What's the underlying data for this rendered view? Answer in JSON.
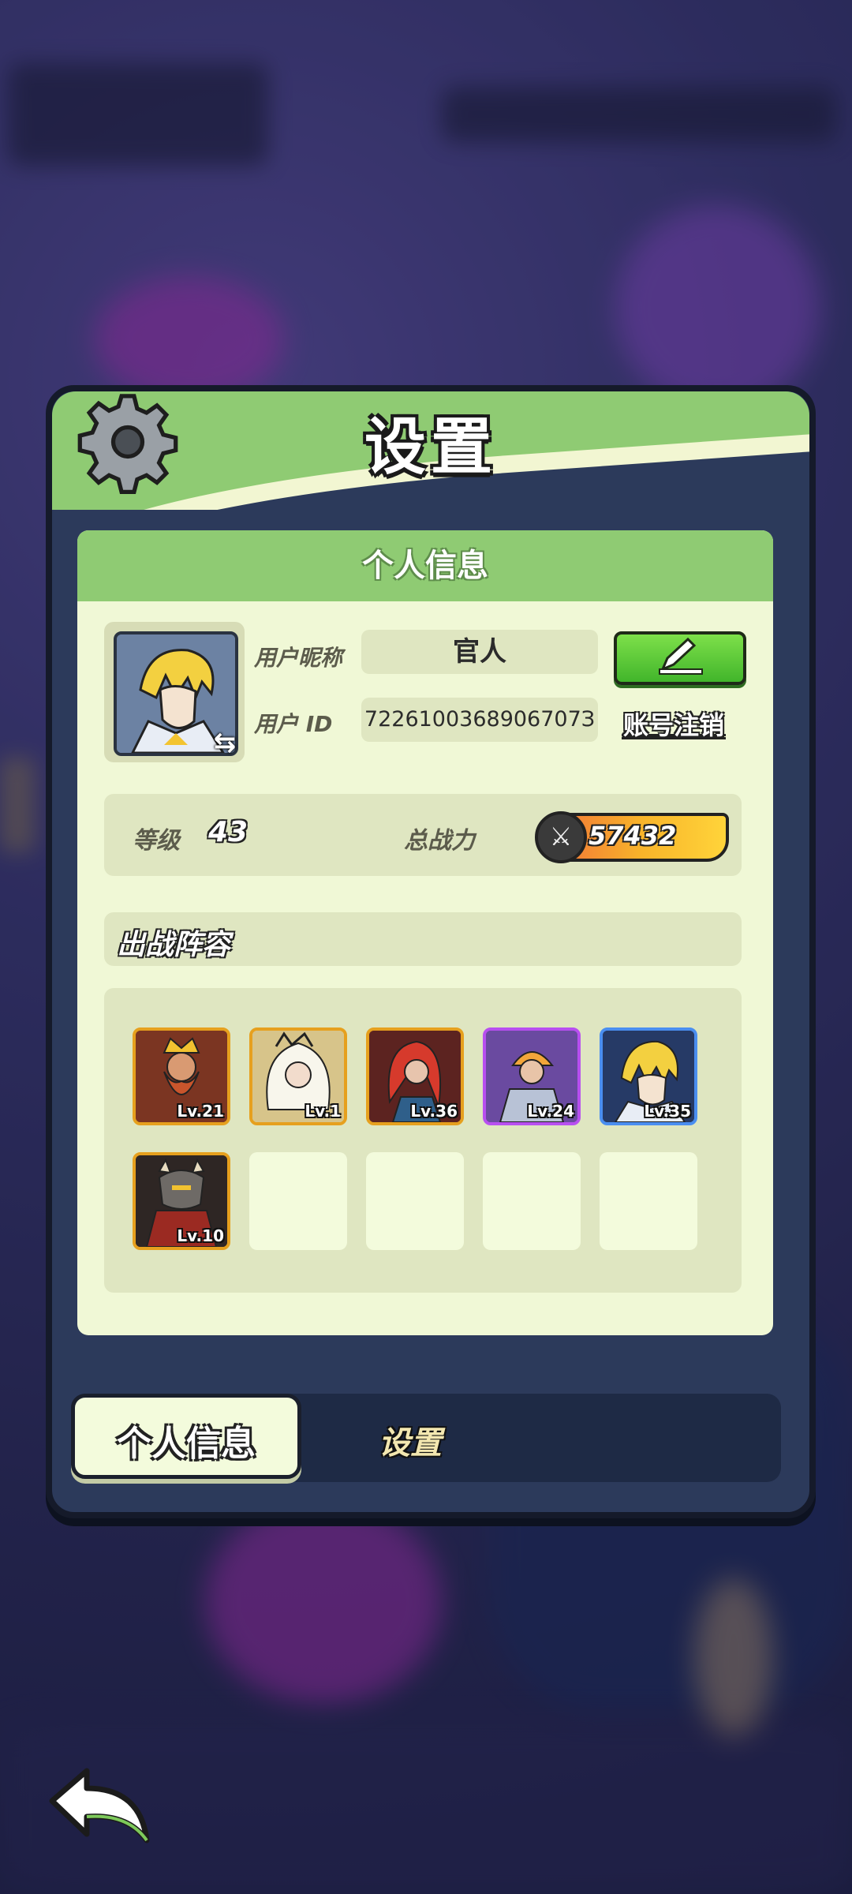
{
  "panel": {
    "title": "设置",
    "section_title": "个人信息"
  },
  "profile": {
    "nickname_label": "用户昵称",
    "nickname_value": "官人",
    "id_label": "用户  ID",
    "id_value": "7226100368906707З",
    "cancel_account": "账号注销",
    "edit_icon": "pencil-icon",
    "swap_icon": "swap-arrows-icon"
  },
  "stats": {
    "level_label": "等级",
    "level_value": "43",
    "power_label": "总战力",
    "power_value": "57432",
    "power_icon": "crossed-swords-icon"
  },
  "lineup": {
    "title": "出战阵容",
    "heroes": [
      {
        "level": "Lv.21",
        "frame": "gold"
      },
      {
        "level": "Lv.1",
        "frame": "gold"
      },
      {
        "level": "Lv.36",
        "frame": "gold"
      },
      {
        "level": "Lv.24",
        "frame": "purple"
      },
      {
        "level": "Lv.35",
        "frame": "blue"
      },
      {
        "level": "Lv.10",
        "frame": "gold"
      }
    ],
    "empty_slots": 4
  },
  "tabs": [
    {
      "label": "个人信息",
      "active": true
    },
    {
      "label": "设置",
      "active": false
    }
  ],
  "colors": {
    "header_green": "#8fcb73",
    "card_cream": "#f0f8d6",
    "edit_green": "#42b52b",
    "gold_frame": "#e6a01e",
    "purple_frame": "#b84ff0",
    "blue_frame": "#4a8ef0"
  },
  "icons": {
    "settings": "gear-icon",
    "back": "back-arrow-icon"
  }
}
